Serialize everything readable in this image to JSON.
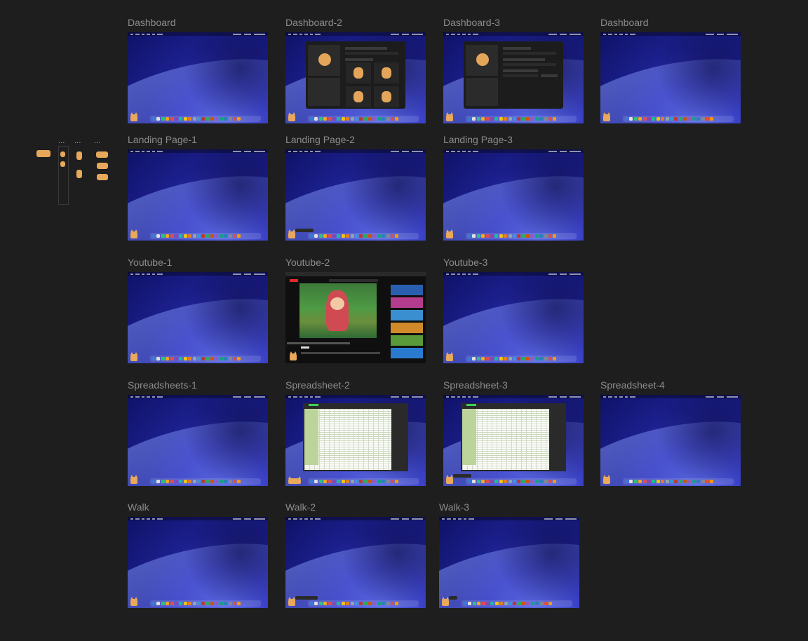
{
  "frames": {
    "f_dashboard": "Dashboard",
    "f_dashboard2": "Dashboard-2",
    "f_dashboard3": "Dashboard-3",
    "f_dashboard4": "Dashboard",
    "f_landing1": "Landing Page-1",
    "f_landing2": "Landing Page-2",
    "f_landing3": "Landing Page-3",
    "f_youtube1": "Youtube-1",
    "f_youtube2": "Youtube-2",
    "f_youtube3": "Youtube-3",
    "f_sheets1": "Spreadsheets-1",
    "f_sheet2": "Spreadsheet-2",
    "f_sheet3": "Spreadsheet-3",
    "f_sheets4": "Spreadsheet-4",
    "f_walk": "Walk",
    "f_walk2": "Walk-2",
    "f_walk3": "Walk-3"
  },
  "sprites": {
    "dots": "..."
  },
  "dashboard_window": {
    "brand": "WOOF"
  },
  "colors": {
    "canvas": "#1e1e1e",
    "label": "#8c8c8c",
    "wallpaper_dark": "#0f1266",
    "wallpaper_light": "#5a6ae0",
    "pet": "#e9a85a"
  }
}
